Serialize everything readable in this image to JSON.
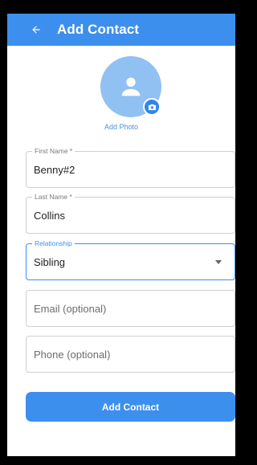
{
  "appbar": {
    "title": "Add Contact",
    "back_icon": "arrow-left-icon",
    "color": "#3d8fee"
  },
  "photo": {
    "label": "Add Photo",
    "avatar_icon": "person-icon",
    "badge_icon": "camera-icon",
    "avatar_color": "#91c0f3"
  },
  "form": {
    "first_name": {
      "label": "First Name *",
      "value": "Benny#2"
    },
    "last_name": {
      "label": "Last Name *",
      "value": "Collins"
    },
    "relationship": {
      "label": "Relationship",
      "value": "Sibling"
    },
    "email": {
      "placeholder": "Email (optional)"
    },
    "phone": {
      "placeholder": "Phone (optional)"
    }
  },
  "submit": {
    "label": "Add Contact"
  }
}
